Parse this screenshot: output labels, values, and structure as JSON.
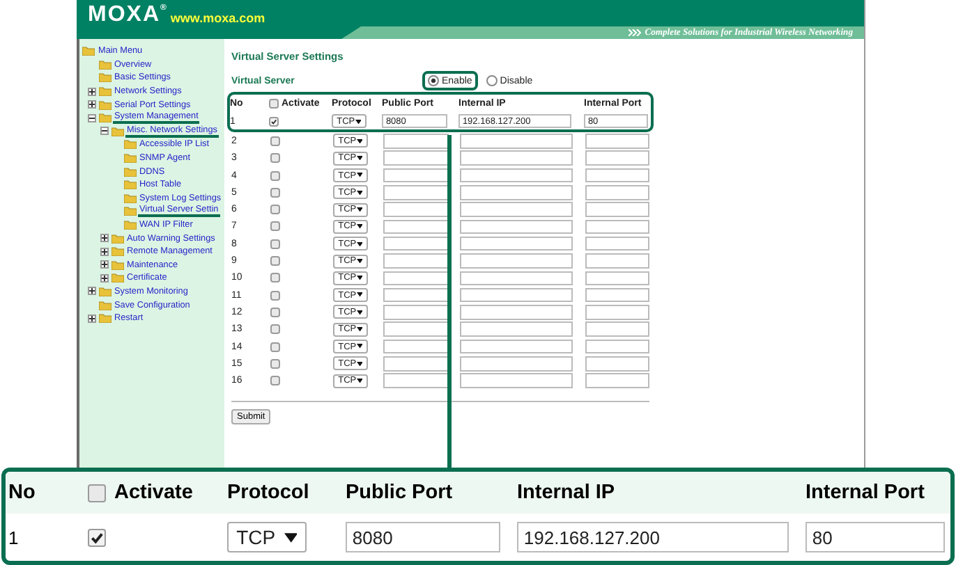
{
  "header": {
    "logo": "MOXA$^{®}$",
    "url": "www.moxa.com",
    "tagline": "Complete Solutions for Industrial Wireless Networking"
  },
  "sidebar": {
    "items": [
      {
        "label": "Main Menu",
        "kind": "root",
        "marked": false,
        "children": [
          {
            "label": "Overview",
            "kind": "leaf",
            "marked": false
          },
          {
            "label": "Basic Settings",
            "kind": "leaf",
            "marked": false
          },
          {
            "label": "Network Settings",
            "kind": "branch",
            "expanded": false,
            "marked": false
          },
          {
            "label": "Serial Port Settings",
            "kind": "branch",
            "expanded": false,
            "marked": false
          },
          {
            "label": "System Management",
            "kind": "branch",
            "expanded": true,
            "marked": true,
            "children": [
              {
                "label": "Misc. Network Settings",
                "kind": "branch",
                "expanded": true,
                "marked": true,
                "children": [
                  {
                    "label": "Accessible IP List",
                    "kind": "leaf",
                    "marked": false
                  },
                  {
                    "label": "SNMP Agent",
                    "kind": "leaf",
                    "marked": false
                  },
                  {
                    "label": "DDNS",
                    "kind": "leaf",
                    "marked": false
                  },
                  {
                    "label": "Host Table",
                    "kind": "leaf",
                    "marked": false
                  },
                  {
                    "label": "System Log Settings",
                    "kind": "leaf",
                    "marked": false
                  },
                  {
                    "label": "Virtual Server Settin",
                    "kind": "leaf",
                    "marked": true
                  },
                  {
                    "label": "WAN IP Filter",
                    "kind": "leaf",
                    "marked": false
                  }
                ]
              },
              {
                "label": "Auto Warning Settings",
                "kind": "branch",
                "expanded": false,
                "marked": false
              },
              {
                "label": "Remote Management",
                "kind": "branch",
                "expanded": false,
                "marked": false
              },
              {
                "label": "Maintenance",
                "kind": "branch",
                "expanded": false,
                "marked": false
              },
              {
                "label": "Certificate",
                "kind": "branch",
                "expanded": false,
                "marked": false
              }
            ]
          },
          {
            "label": "System Monitoring",
            "kind": "branch",
            "expanded": false,
            "marked": false
          },
          {
            "label": "Save Configuration",
            "kind": "leaf",
            "marked": false
          },
          {
            "label": "Restart",
            "kind": "branch",
            "expanded": false,
            "marked": false
          }
        ]
      }
    ]
  },
  "content": {
    "title": "Virtual Server Settings",
    "label": "Virtual Server",
    "options": [
      {
        "label": "Enable",
        "selected": true,
        "marked": true
      },
      {
        "label": "Disable",
        "selected": false,
        "marked": false
      }
    ],
    "table": {
      "columns": [
        "No",
        "Activate",
        "Protocol",
        "Public Port",
        "Internal IP",
        "Internal Port"
      ],
      "activate_all": false,
      "rows": [
        {
          "no": "1",
          "activate": true,
          "protocol": "TCP",
          "public_port": "8080",
          "internal_ip": "192.168.127.200",
          "internal_port": "80",
          "marked": true
        },
        {
          "no": "2",
          "activate": false,
          "protocol": "TCP",
          "marked": false
        },
        {
          "no": "3",
          "activate": false,
          "protocol": "TCP",
          "marked": false
        },
        {
          "no": "4",
          "activate": false,
          "protocol": "TCP",
          "marked": false
        },
        {
          "no": "5",
          "activate": false,
          "protocol": "TCP",
          "marked": false
        },
        {
          "no": "6",
          "activate": false,
          "protocol": "TCP",
          "marked": false
        },
        {
          "no": "7",
          "activate": false,
          "protocol": "TCP",
          "marked": false
        },
        {
          "no": "8",
          "activate": false,
          "protocol": "TCP",
          "marked": false
        },
        {
          "no": "9",
          "activate": false,
          "protocol": "TCP",
          "marked": false
        },
        {
          "no": "10",
          "activate": false,
          "protocol": "TCP",
          "marked": false
        },
        {
          "no": "11",
          "activate": false,
          "protocol": "TCP",
          "marked": false
        },
        {
          "no": "12",
          "activate": false,
          "protocol": "TCP",
          "marked": false
        },
        {
          "no": "13",
          "activate": false,
          "protocol": "TCP",
          "marked": false
        },
        {
          "no": "14",
          "activate": false,
          "protocol": "TCP",
          "marked": false
        },
        {
          "no": "15",
          "activate": false,
          "protocol": "TCP",
          "marked": false
        },
        {
          "no": "16",
          "activate": false,
          "protocol": "TCP",
          "marked": false
        }
      ]
    },
    "submit": "Submit"
  },
  "callout": {
    "columns": [
      "No",
      "Activate",
      "Protocol",
      "Public Port",
      "Internal IP",
      "Internal Port"
    ],
    "activate_all": false,
    "rows": [
      {
        "no": "1",
        "activate": true,
        "protocol": "TCP",
        "public_port": "8080",
        "internal_ip": "192.168.127.200",
        "internal_port": "80"
      }
    ]
  }
}
